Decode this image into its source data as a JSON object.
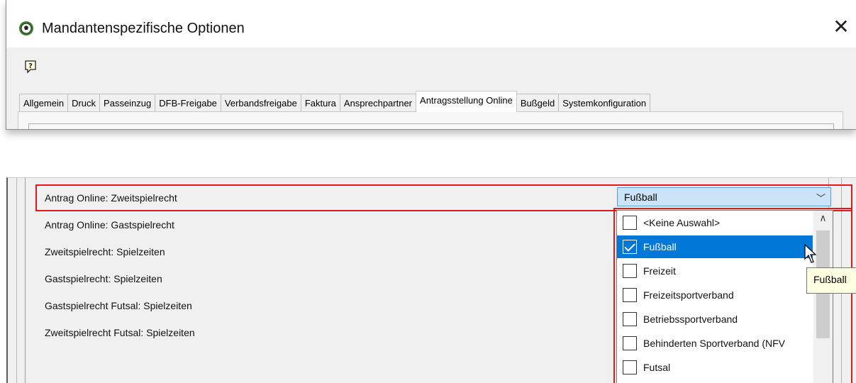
{
  "window": {
    "title": "Mandantenspezifische Optionen",
    "close_glyph": "✕",
    "app_icon": "soccer-ball-icon",
    "help_icon": "help-icon"
  },
  "tabs": [
    {
      "label": "Allgemein",
      "active": false
    },
    {
      "label": "Druck",
      "active": false
    },
    {
      "label": "Passeinzug",
      "active": false
    },
    {
      "label": "DFB-Freigabe",
      "active": false
    },
    {
      "label": "Verbandsfreigabe",
      "active": false
    },
    {
      "label": "Faktura",
      "active": false
    },
    {
      "label": "Ansprechpartner",
      "active": false
    },
    {
      "label": "Antragsstellung Online",
      "active": true
    },
    {
      "label": "Bußgeld",
      "active": false
    },
    {
      "label": "Systemkonfiguration",
      "active": false
    }
  ],
  "options": [
    {
      "label": "Antrag Online: Zweitspielrecht"
    },
    {
      "label": "Antrag Online: Gastspielrecht"
    },
    {
      "label": "Zweitspielrecht: Spielzeiten"
    },
    {
      "label": "Gastspielrecht: Spielzeiten"
    },
    {
      "label": "Gastspielrecht Futsal: Spielzeiten"
    },
    {
      "label": "Zweitspielrecht Futsal: Spielzeiten"
    }
  ],
  "combo": {
    "value": "Fußball",
    "arrow_glyph": "﹀"
  },
  "dropdown": {
    "items": [
      {
        "label": "<Keine Auswahl>",
        "checked": false,
        "selected": false
      },
      {
        "label": "Fußball",
        "checked": true,
        "selected": true
      },
      {
        "label": "Freizeit",
        "checked": false,
        "selected": false
      },
      {
        "label": "Freizeitsportverband",
        "checked": false,
        "selected": false
      },
      {
        "label": "Betriebssportverband",
        "checked": false,
        "selected": false
      },
      {
        "label": "Behinderten Sportverband (NFV",
        "checked": false,
        "selected": false
      },
      {
        "label": "Futsal",
        "checked": false,
        "selected": false
      }
    ],
    "scroll_up_glyph": "∧"
  },
  "tooltip": {
    "text": "Fußball"
  },
  "colors": {
    "highlight": "#e01a1a",
    "selection": "#0078d7",
    "combo_bg": "#cce4f7",
    "tooltip_bg": "#ffffe1"
  }
}
